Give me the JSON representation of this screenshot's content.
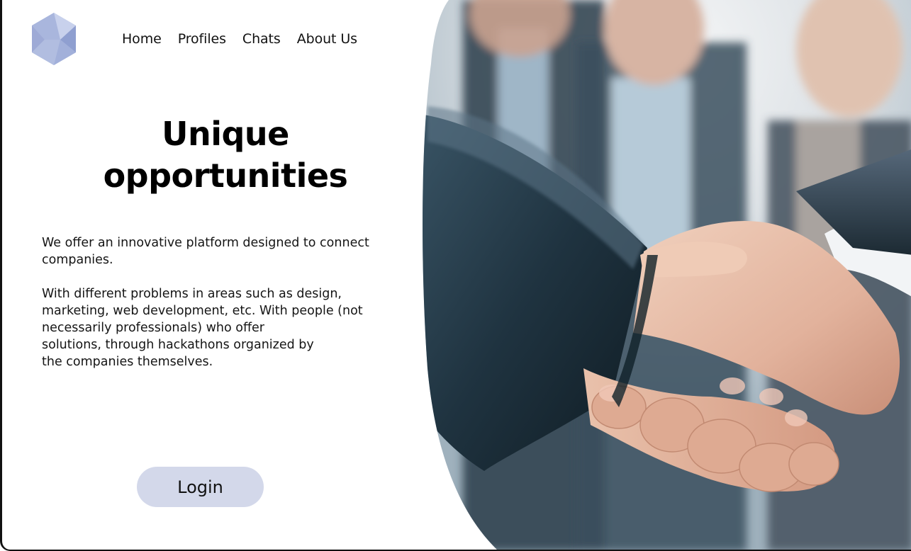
{
  "logo": {
    "icon": "polyhedron-logo-icon"
  },
  "nav": {
    "items": [
      {
        "label": "Home"
      },
      {
        "label": "Profiles"
      },
      {
        "label": "Chats"
      },
      {
        "label": "About Us"
      }
    ]
  },
  "hero": {
    "title_line1": "Unique",
    "title_line2": "opportunities",
    "paragraph1": [
      "We offer an innovative platform designed to connect",
      "companies."
    ],
    "paragraph2": [
      "With different problems in areas such as design,",
      "marketing, web development, etc. With people (not",
      "necessarily professionals) who offer",
      "solutions, through hackathons organized by",
      "the companies themselves."
    ],
    "login_label": "Login",
    "image": "handshake-photo"
  },
  "colors": {
    "button_bg": "#d3d8ea",
    "logo": "#aab6d9",
    "text": "#111111"
  }
}
